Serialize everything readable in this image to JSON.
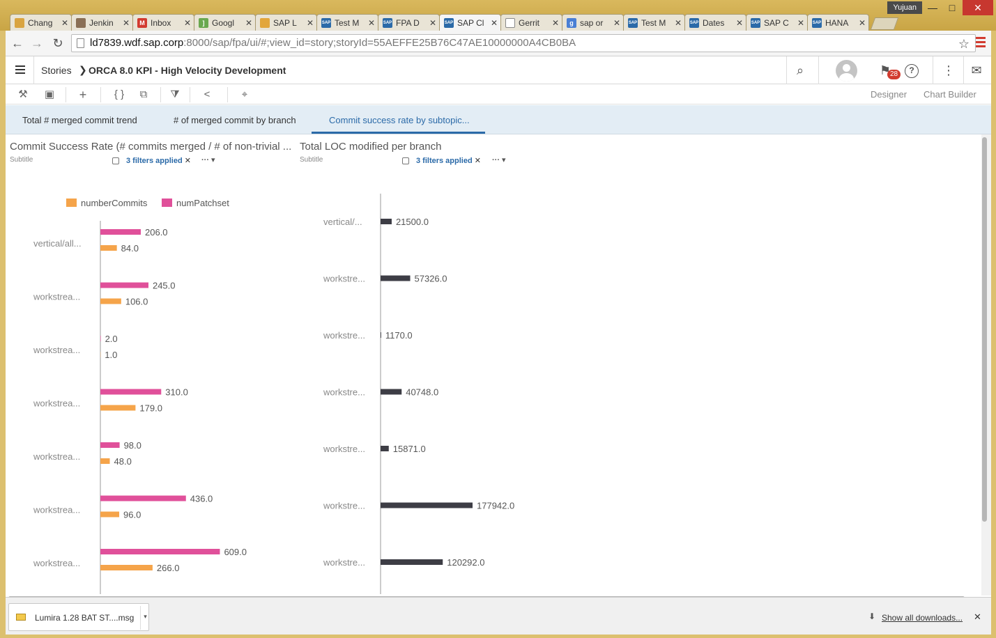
{
  "window": {
    "user": "Yujuan",
    "min": "—",
    "max": "□",
    "close": "✕"
  },
  "tabs": [
    {
      "label": "Chang",
      "fav_color": "#d9a441",
      "fav_glyph": ""
    },
    {
      "label": "Jenkin",
      "fav_color": "#8a6f55",
      "fav_glyph": ""
    },
    {
      "label": "Inbox",
      "fav_color": "#d23b2f",
      "fav_glyph": "M"
    },
    {
      "label": "Googl",
      "fav_color": "#6aa84f",
      "fav_glyph": "]"
    },
    {
      "label": "SAP L",
      "fav_color": "#e2a63b",
      "fav_glyph": ""
    },
    {
      "label": "Test M",
      "fav_color": "#2b6aa8",
      "fav_glyph": "SAP"
    },
    {
      "label": "FPA D",
      "fav_color": "#2b6aa8",
      "fav_glyph": "SAP"
    },
    {
      "label": "SAP Cl",
      "fav_color": "#2b6aa8",
      "fav_glyph": "SAP",
      "active": true
    },
    {
      "label": "Gerrit",
      "fav_color": "#ffffff",
      "fav_glyph": ""
    },
    {
      "label": "sap or",
      "fav_color": "#4a7fd4",
      "fav_glyph": "g"
    },
    {
      "label": "Test M",
      "fav_color": "#2b6aa8",
      "fav_glyph": "SAP"
    },
    {
      "label": "Dates",
      "fav_color": "#2b6aa8",
      "fav_glyph": "SAP"
    },
    {
      "label": "SAP C",
      "fav_color": "#2b6aa8",
      "fav_glyph": "SAP"
    },
    {
      "label": "HANA",
      "fav_color": "#2b6aa8",
      "fav_glyph": "SAP"
    }
  ],
  "addressbar": {
    "host": "ld7839.wdf.sap.corp",
    "path": ":8000/sap/fpa/ui/#;view_id=story;storyId=55AEFFE25B76C47AE10000000A4CB0BA",
    "back": "←",
    "forward": "→",
    "reload": "↻",
    "star": "☆"
  },
  "shell": {
    "breadcrumb": "Stories",
    "arrow": "❯",
    "title": "ORCA 8.0 KPI - High Velocity Development",
    "notifications": "28",
    "search_glyph": "⌕",
    "help_glyph": "?",
    "more_glyph": "⋮",
    "chat_glyph": "✉",
    "notif_glyph": "⚑"
  },
  "toolbar": {
    "tools_glyph": "⚒",
    "save_glyph": "▣",
    "add_glyph": "+",
    "formula_glyph": "{ }",
    "copy_glyph": "⧉",
    "filter_glyph": "⧩",
    "share_glyph": "<",
    "pin_glyph": "⌖",
    "designer": "Designer",
    "chart_builder": "Chart Builder"
  },
  "page_tabs": [
    {
      "label": "Total # merged commit trend"
    },
    {
      "label": "# of merged commit by branch"
    },
    {
      "label": "Commit success rate by subtopic...",
      "active": true
    }
  ],
  "downloads": {
    "file": "Lumira 1.28 BAT ST....msg",
    "arrow": "▾",
    "show_all": "Show all downloads...",
    "down_glyph": "⬇",
    "close": "✕"
  },
  "chart_data": [
    {
      "type": "bar",
      "orientation": "horizontal",
      "title": "Commit Success Rate (# commits merged / # of non-trivial ...",
      "subtitle": "Subtitle",
      "filters": "3 filters applied",
      "more": "···",
      "categories": [
        "vertical/all...",
        "workstrea...",
        "workstrea...",
        "workstrea...",
        "workstrea...",
        "workstrea...",
        "workstrea..."
      ],
      "legend_position": "top-left",
      "series": [
        {
          "name": "numPatchset",
          "color": "#e0509a",
          "values": [
            206.0,
            245.0,
            2.0,
            310.0,
            98.0,
            436.0,
            609.0
          ]
        },
        {
          "name": "numberCommits",
          "color": "#f5a44a",
          "values": [
            84.0,
            106.0,
            1.0,
            179.0,
            48.0,
            96.0,
            266.0
          ]
        }
      ],
      "legend_order": [
        "numberCommits",
        "numPatchset"
      ]
    },
    {
      "type": "bar",
      "orientation": "horizontal",
      "title": "Total LOC modified per branch",
      "subtitle": "Subtitle",
      "filters": "3 filters applied",
      "more": "···",
      "categories": [
        "vertical/...",
        "workstre...",
        "workstre...",
        "workstre...",
        "workstre...",
        "workstre...",
        "workstre..."
      ],
      "series": [
        {
          "name": "",
          "color": "#3d3d45",
          "values": [
            21500.0,
            57326.0,
            1170.0,
            40748.0,
            15871.0,
            177942.0,
            120292.0
          ]
        }
      ]
    }
  ]
}
